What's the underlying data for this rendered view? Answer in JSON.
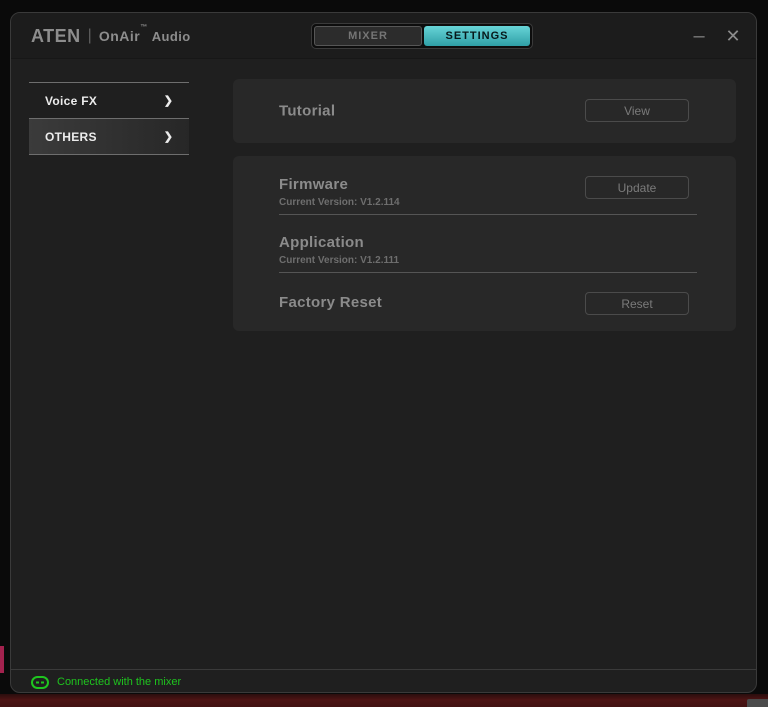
{
  "titlebar": {
    "logo": {
      "brand": "ATEN",
      "divider": "|",
      "product": "OnAir",
      "tm": "™",
      "suffix": "Audio"
    },
    "tabs": {
      "mixer": "MIXER",
      "settings": "SETTINGS"
    },
    "controls": {
      "minimize": "–",
      "close": "✕"
    }
  },
  "sidebar": {
    "chevron": "❯",
    "items": [
      {
        "label": "Voice FX",
        "selected": false
      },
      {
        "label": "OTHERS",
        "selected": true
      }
    ]
  },
  "content": {
    "tutorial": {
      "title": "Tutorial",
      "button": "View"
    },
    "firmware": {
      "title": "Firmware",
      "version": "Current Version: V1.2.114",
      "button": "Update"
    },
    "application": {
      "title": "Application",
      "version": "Current Version: V1.2.111"
    },
    "factory_reset": {
      "title": "Factory Reset",
      "button": "Reset"
    }
  },
  "statusbar": {
    "text": "Connected with the mixer"
  },
  "colors": {
    "accent_teal": "#3fb9be",
    "status_green": "#1fc41f",
    "window_bg": "#1f1f1f",
    "card_bg": "#282828"
  }
}
